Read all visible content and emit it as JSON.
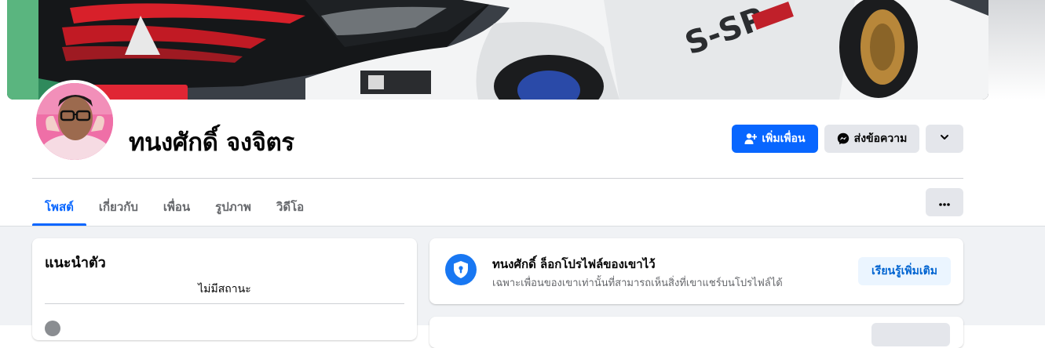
{
  "profile": {
    "name": "ทนงศักดิ์ จงจิตร"
  },
  "actions": {
    "add_friend": "เพิ่มเพื่อน",
    "message": "ส่งข้อความ"
  },
  "tabs": [
    {
      "label": "โพสต์",
      "active": true
    },
    {
      "label": "เกี่ยวกับ",
      "active": false
    },
    {
      "label": "เพื่อน",
      "active": false
    },
    {
      "label": "รูปภาพ",
      "active": false
    },
    {
      "label": "วิดีโอ",
      "active": false
    }
  ],
  "intro": {
    "title": "แนะนำตัว",
    "status": "ไม่มีสถานะ"
  },
  "locked_notice": {
    "title": "ทนงศักดิ์ ล็อกโปรไฟล์ของเขาไว้",
    "description": "เฉพาะเพื่อนของเขาเท่านั้นที่สามารถเห็นสิ่งที่เขาแชร์บนโปรไฟล์ได้",
    "learn_more": "เรียนรู้เพิ่มเติม"
  },
  "icons": {
    "add_friend": "person-add-icon",
    "message": "messenger-icon",
    "expand": "chevron-down-icon",
    "more": "ellipsis-icon",
    "lock": "shield-lock-icon"
  },
  "colors": {
    "accent": "#0866ff",
    "secondary_button": "#e4e6eb",
    "page_background": "#f0f2f5",
    "lock_badge": "#1877f2"
  }
}
